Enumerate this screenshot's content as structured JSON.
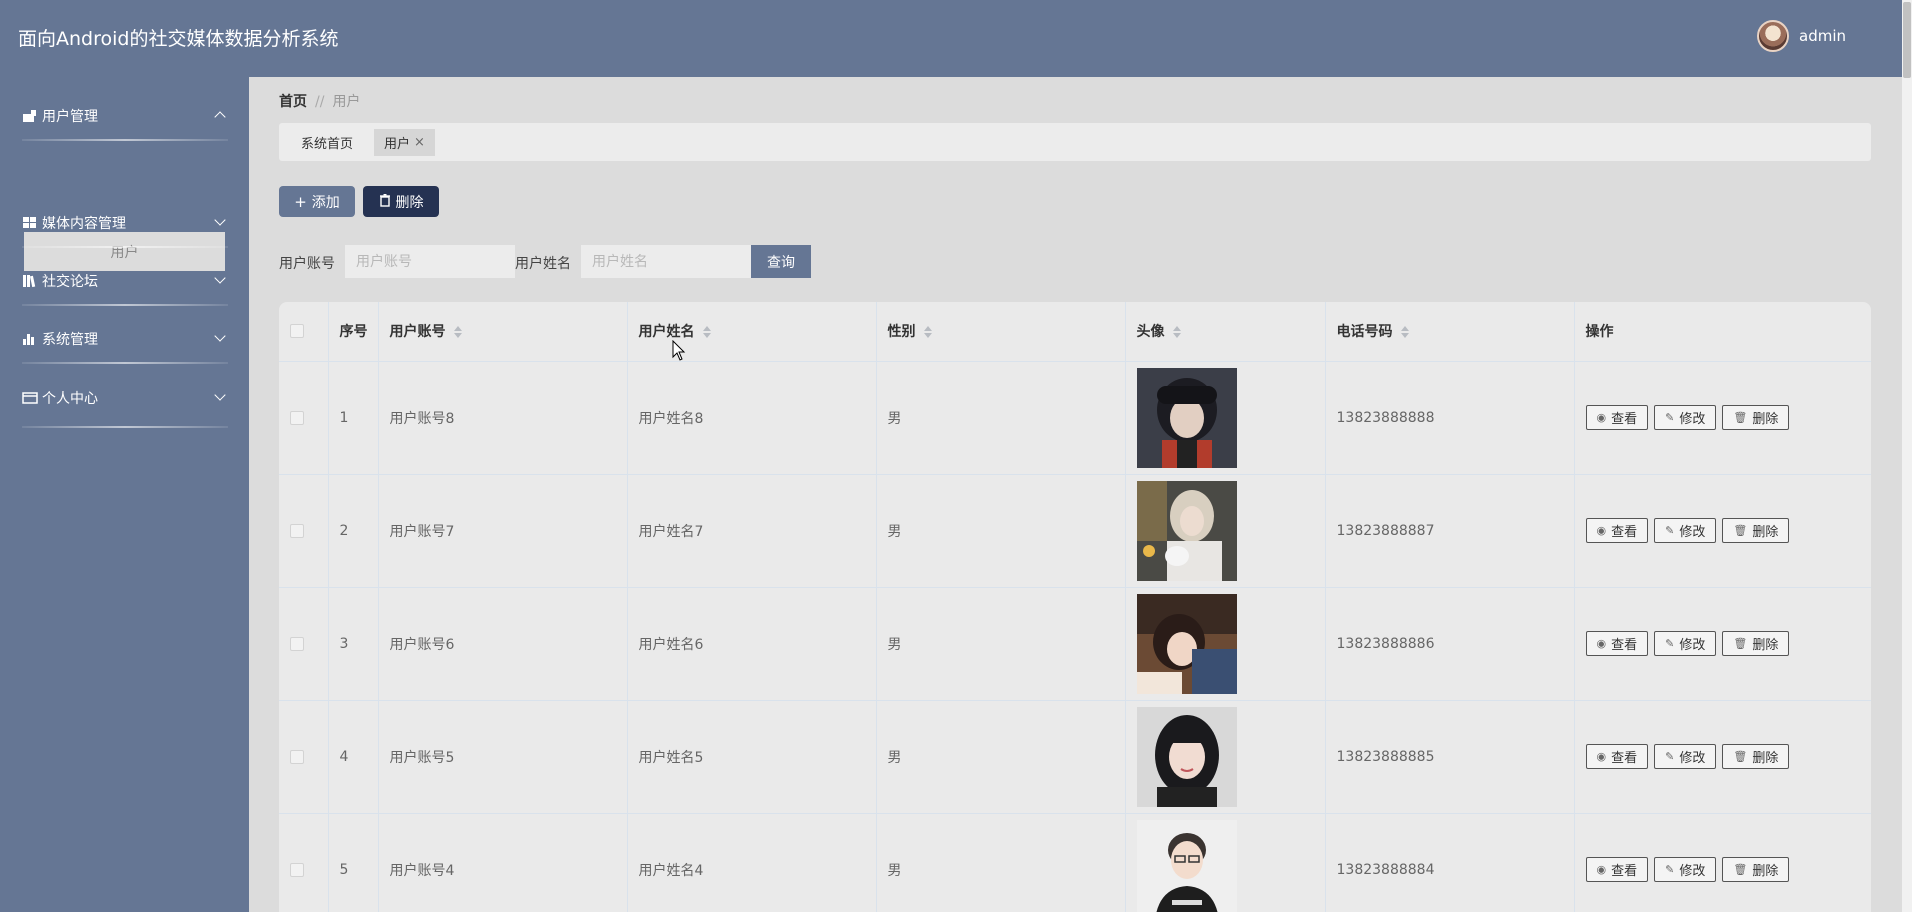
{
  "header": {
    "title": "面向Android的社交媒体数据分析系统",
    "user": "admin"
  },
  "sidebar": {
    "items": [
      {
        "label": "用户管理",
        "icon": "user-manage-icon"
      },
      {
        "label": "媒体内容管理",
        "icon": "grid-icon"
      },
      {
        "label": "社交论坛",
        "icon": "books-icon"
      },
      {
        "label": "系统管理",
        "icon": "bar-chart-icon"
      },
      {
        "label": "个人中心",
        "icon": "card-icon"
      }
    ],
    "submenu": {
      "label": "用户"
    }
  },
  "breadcrumb": {
    "home": "首页",
    "sep": "//",
    "current": "用户"
  },
  "tabs": [
    {
      "label": "系统首页"
    },
    {
      "label": "用户",
      "close": "×"
    }
  ],
  "toolbar": {
    "add": "添加",
    "delete": "删除"
  },
  "filters": {
    "account_label": "用户账号",
    "account_placeholder": "用户账号",
    "name_label": "用户姓名",
    "name_placeholder": "用户姓名",
    "query": "查询"
  },
  "table": {
    "headers": [
      "序号",
      "用户账号",
      "用户姓名",
      "性别",
      "头像",
      "电话号码",
      "操作"
    ],
    "rows": [
      {
        "idx": "1",
        "account": "用户账号8",
        "name": "用户姓名8",
        "gender": "男",
        "phone": "13823888888"
      },
      {
        "idx": "2",
        "account": "用户账号7",
        "name": "用户姓名7",
        "gender": "男",
        "phone": "13823888887"
      },
      {
        "idx": "3",
        "account": "用户账号6",
        "name": "用户姓名6",
        "gender": "男",
        "phone": "13823888886"
      },
      {
        "idx": "4",
        "account": "用户账号5",
        "name": "用户姓名5",
        "gender": "男",
        "phone": "13823888885"
      },
      {
        "idx": "5",
        "account": "用户账号4",
        "name": "用户姓名4",
        "gender": "男",
        "phone": "13823888884"
      }
    ],
    "actions": {
      "view": "查看",
      "edit": "修改",
      "delete": "删除"
    }
  },
  "colors": {
    "primary": "#657694",
    "dark": "#253252",
    "background": "#dcdcdc"
  }
}
